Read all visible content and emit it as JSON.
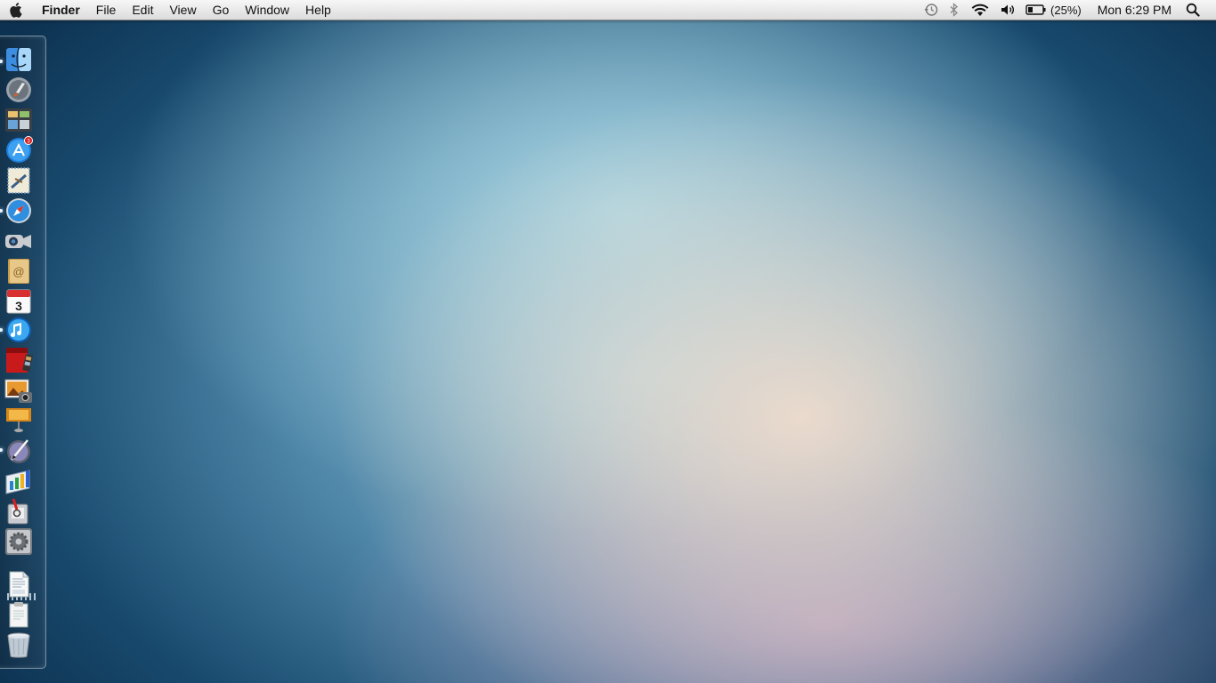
{
  "menubar": {
    "app_name": "Finder",
    "menus": [
      "File",
      "Edit",
      "View",
      "Go",
      "Window",
      "Help"
    ],
    "battery_percent": "(25%)",
    "clock": "Mon 6:29 PM"
  },
  "dock": {
    "items": [
      {
        "name": "Finder",
        "icon": "finder-icon",
        "running": true
      },
      {
        "name": "Launchpad",
        "icon": "launchpad-icon",
        "running": false
      },
      {
        "name": "Mission Control",
        "icon": "mission-control-icon",
        "running": false
      },
      {
        "name": "App Store",
        "icon": "app-store-icon",
        "running": false,
        "badge": "3"
      },
      {
        "name": "Mail",
        "icon": "mail-icon",
        "running": false
      },
      {
        "name": "Safari",
        "icon": "safari-icon",
        "running": true
      },
      {
        "name": "FaceTime",
        "icon": "facetime-icon",
        "running": false
      },
      {
        "name": "Contacts",
        "icon": "contacts-icon",
        "running": false
      },
      {
        "name": "Calendar",
        "icon": "calendar-icon",
        "running": false,
        "date": "3"
      },
      {
        "name": "iTunes",
        "icon": "itunes-icon",
        "running": true
      },
      {
        "name": "Photo Booth",
        "icon": "photo-booth-icon",
        "running": false
      },
      {
        "name": "iPhoto",
        "icon": "iphoto-icon",
        "running": false
      },
      {
        "name": "Keynote",
        "icon": "keynote-icon",
        "running": false
      },
      {
        "name": "Aperture",
        "icon": "aperture-pen-icon",
        "running": true
      },
      {
        "name": "Numbers",
        "icon": "numbers-icon",
        "running": false
      },
      {
        "name": "Preview",
        "icon": "preview-icon",
        "running": false
      },
      {
        "name": "System Preferences",
        "icon": "system-preferences-icon",
        "running": false
      },
      {
        "name": "Pages Document",
        "icon": "pages-doc-icon",
        "running": false
      },
      {
        "name": "Document",
        "icon": "document-icon",
        "running": false
      },
      {
        "name": "Trash",
        "icon": "trash-icon",
        "running": false
      }
    ]
  },
  "colors": {
    "menubar_bg": "#e6e6e6",
    "desktop_accent": "#184a6e",
    "running_indicator": "#e8f4ff"
  }
}
